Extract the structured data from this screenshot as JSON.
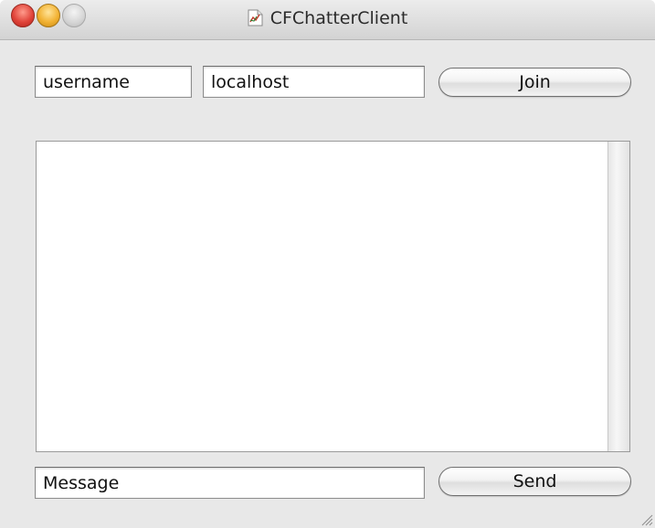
{
  "window": {
    "title": "CFChatterClient"
  },
  "icons": {
    "close": "close-button",
    "minimize": "minimize-button",
    "zoom": "zoom-button",
    "app": "document-app-icon",
    "resize": "resize-grip-icon"
  },
  "connect": {
    "username_value": "username",
    "host_value": "localhost",
    "join_label": "Join"
  },
  "chat": {
    "messages": []
  },
  "compose": {
    "message_value": "Message",
    "send_label": "Send"
  }
}
